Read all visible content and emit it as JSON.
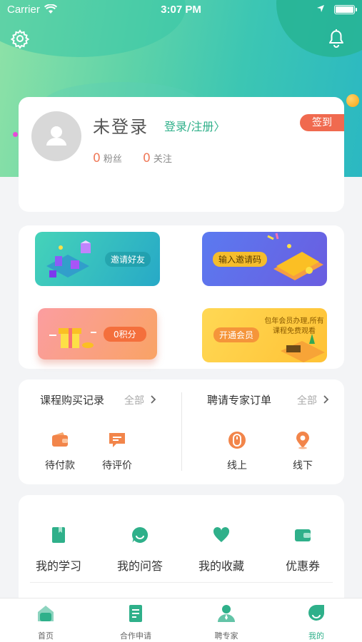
{
  "status_bar": {
    "carrier": "Carrier",
    "time": "3:07 PM"
  },
  "profile": {
    "username": "未登录",
    "login_link": "登录/注册〉",
    "checkin": "签到",
    "fans_count": "0",
    "fans_label": "粉丝",
    "follow_count": "0",
    "follow_label": "关注"
  },
  "promos": [
    {
      "label": "邀请好友"
    },
    {
      "label": "输入邀请码"
    },
    {
      "label": "0积分"
    },
    {
      "label": "开通会员",
      "sub": "包年会员办理,所有课程免费观看"
    }
  ],
  "orders": {
    "course": {
      "title": "课程购买记录",
      "more": "全部",
      "items": [
        {
          "label": "待付款",
          "icon": "wallet-icon"
        },
        {
          "label": "待评价",
          "icon": "comment-icon"
        }
      ]
    },
    "expert": {
      "title": "聘请专家订单",
      "more": "全部",
      "items": [
        {
          "label": "线上",
          "icon": "mouse-icon"
        },
        {
          "label": "线下",
          "icon": "location-pin-icon"
        }
      ]
    }
  },
  "mine": {
    "items": [
      {
        "label": "我的学习",
        "icon": "book-icon"
      },
      {
        "label": "我的问答",
        "icon": "chat-icon"
      },
      {
        "label": "我的收藏",
        "icon": "heart-icon"
      },
      {
        "label": "优惠券",
        "icon": "coupon-icon"
      }
    ]
  },
  "tabbar": {
    "items": [
      {
        "label": "首页",
        "icon": "home-icon"
      },
      {
        "label": "合作申请",
        "icon": "document-icon"
      },
      {
        "label": "聘专家",
        "icon": "expert-icon"
      },
      {
        "label": "我的",
        "icon": "profile-icon"
      }
    ],
    "active_index": 3
  },
  "colors": {
    "accent": "#2fb08a",
    "orange": "#f07a5a",
    "checkin": "#f06a4f"
  }
}
